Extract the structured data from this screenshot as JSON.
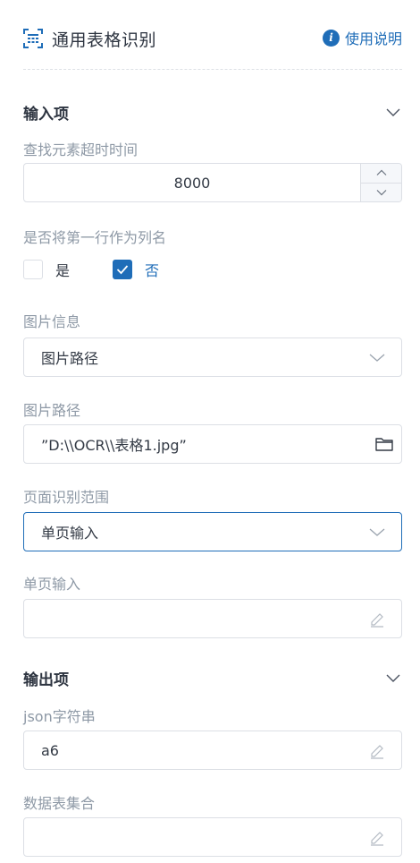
{
  "header": {
    "title": "通用表格识别",
    "help_label": "使用说明"
  },
  "inputs": {
    "section_title": "输入项",
    "timeout": {
      "label": "查找元素超时时间",
      "value": "8000"
    },
    "first_row": {
      "label": "是否将第一行作为列名",
      "options": [
        {
          "label": "是",
          "checked": false
        },
        {
          "label": "否",
          "checked": true
        }
      ]
    },
    "image_info": {
      "label": "图片信息",
      "value": "图片路径"
    },
    "image_path": {
      "label": "图片路径",
      "value": "”D:\\\\OCR\\\\表格1.jpg”"
    },
    "page_range": {
      "label": "页面识别范围",
      "value": "单页输入"
    },
    "single_page": {
      "label": "单页输入",
      "value": ""
    }
  },
  "outputs": {
    "section_title": "输出项",
    "json_string": {
      "label": "json字符串",
      "value": "a6"
    },
    "dataset": {
      "label": "数据表集合",
      "value": ""
    }
  },
  "colors": {
    "accent": "#1f6db8",
    "label": "#8e99a6",
    "border": "#dcdfe5"
  }
}
